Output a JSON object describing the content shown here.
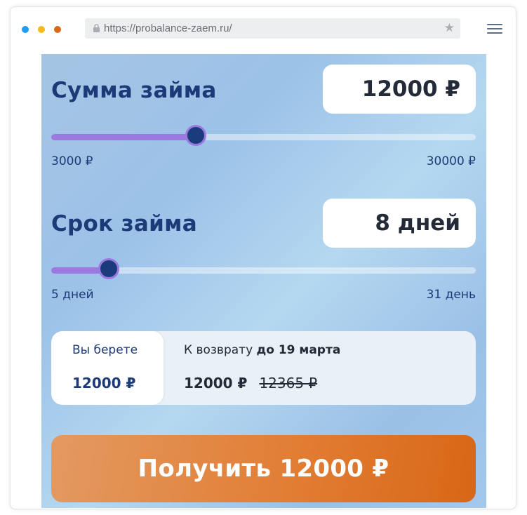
{
  "browser": {
    "url": "https://probalance-zaem.ru/",
    "dot_colors": [
      "#1e9cf0",
      "#f5bb1c",
      "#d96718"
    ]
  },
  "amount": {
    "label": "Сумма займа",
    "value": "12000 ₽",
    "min_label": "3000 ₽",
    "max_label": "30000 ₽",
    "slider_fraction": 0.34
  },
  "term": {
    "label": "Срок займа",
    "value": "8 дней",
    "min_label": "5 дней",
    "max_label": "31 день",
    "slider_fraction": 0.135
  },
  "summary": {
    "take_label": "Вы берете",
    "take_value": "12000 ₽",
    "return_label": "К возврату",
    "return_date": "до 19 марта",
    "return_value": "12000 ₽",
    "return_old_value": "12365 ₽"
  },
  "cta": {
    "label": "Получить 12000 ₽",
    "color": "#e27e35"
  },
  "colors": {
    "accent_slider": "#9b79e0",
    "text_primary": "#1d3a78"
  }
}
